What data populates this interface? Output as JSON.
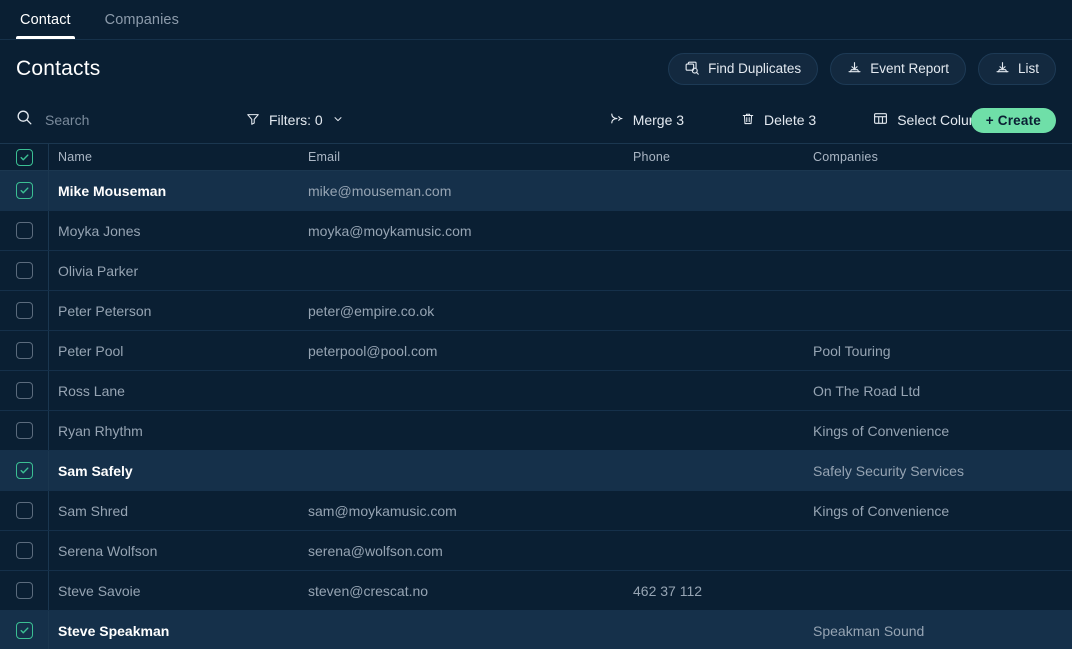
{
  "tabs": [
    {
      "label": "Contact",
      "active": true
    },
    {
      "label": "Companies",
      "active": false
    }
  ],
  "header": {
    "title": "Contacts",
    "actions": [
      {
        "label": "Find Duplicates",
        "icon": "find-duplicates-icon"
      },
      {
        "label": "Event Report",
        "icon": "download-icon"
      },
      {
        "label": "List",
        "icon": "download-icon"
      }
    ]
  },
  "toolbar": {
    "search_placeholder": "Search",
    "search_value": "",
    "search_icon": "search-icon",
    "filters_label": "Filters: 0",
    "filters_icon": "filter-icon",
    "filters_chevron": "chevron-down-icon",
    "merge_label": "Merge 3",
    "merge_icon": "merge-icon",
    "delete_label": "Delete 3",
    "delete_icon": "trash-icon",
    "columns_label": "Select Columns",
    "columns_icon": "table-columns-icon",
    "columns_chevron": "chevron-down-icon",
    "create_label": "+ Create"
  },
  "colors": {
    "page_background": "#0a1f33",
    "row_selected_background": "#15304a",
    "accent_green": "#6fdfa8",
    "checkbox_checked": "#3bbf93",
    "text_primary": "#ffffff",
    "text_secondary": "#96a4b3",
    "divider": "#1b3750"
  },
  "table": {
    "select_all_checked": true,
    "columns": [
      {
        "key": "name",
        "label": "Name"
      },
      {
        "key": "email",
        "label": "Email"
      },
      {
        "key": "phone",
        "label": "Phone"
      },
      {
        "key": "companies",
        "label": "Companies"
      }
    ],
    "rows": [
      {
        "selected": true,
        "name": "Mike Mouseman",
        "email": "mike@mouseman.com",
        "phone": "",
        "companies": ""
      },
      {
        "selected": false,
        "name": "Moyka Jones",
        "email": "moyka@moykamusic.com",
        "phone": "",
        "companies": ""
      },
      {
        "selected": false,
        "name": "Olivia Parker",
        "email": "",
        "phone": "",
        "companies": ""
      },
      {
        "selected": false,
        "name": "Peter Peterson",
        "email": "peter@empire.co.ok",
        "phone": "",
        "companies": ""
      },
      {
        "selected": false,
        "name": "Peter Pool",
        "email": "peterpool@pool.com",
        "phone": "",
        "companies": "Pool Touring"
      },
      {
        "selected": false,
        "name": "Ross Lane",
        "email": "",
        "phone": "",
        "companies": "On The Road Ltd"
      },
      {
        "selected": false,
        "name": "Ryan Rhythm",
        "email": "",
        "phone": "",
        "companies": "Kings of Convenience"
      },
      {
        "selected": true,
        "name": "Sam Safely",
        "email": "",
        "phone": "",
        "companies": "Safely Security Services"
      },
      {
        "selected": false,
        "name": "Sam Shred",
        "email": "sam@moykamusic.com",
        "phone": "",
        "companies": "Kings of Convenience"
      },
      {
        "selected": false,
        "name": "Serena Wolfson",
        "email": "serena@wolfson.com",
        "phone": "",
        "companies": ""
      },
      {
        "selected": false,
        "name": "Steve Savoie",
        "email": "steven@crescat.no",
        "phone": "462 37 112",
        "companies": ""
      },
      {
        "selected": true,
        "name": "Steve Speakman",
        "email": "",
        "phone": "",
        "companies": "Speakman Sound"
      }
    ]
  }
}
